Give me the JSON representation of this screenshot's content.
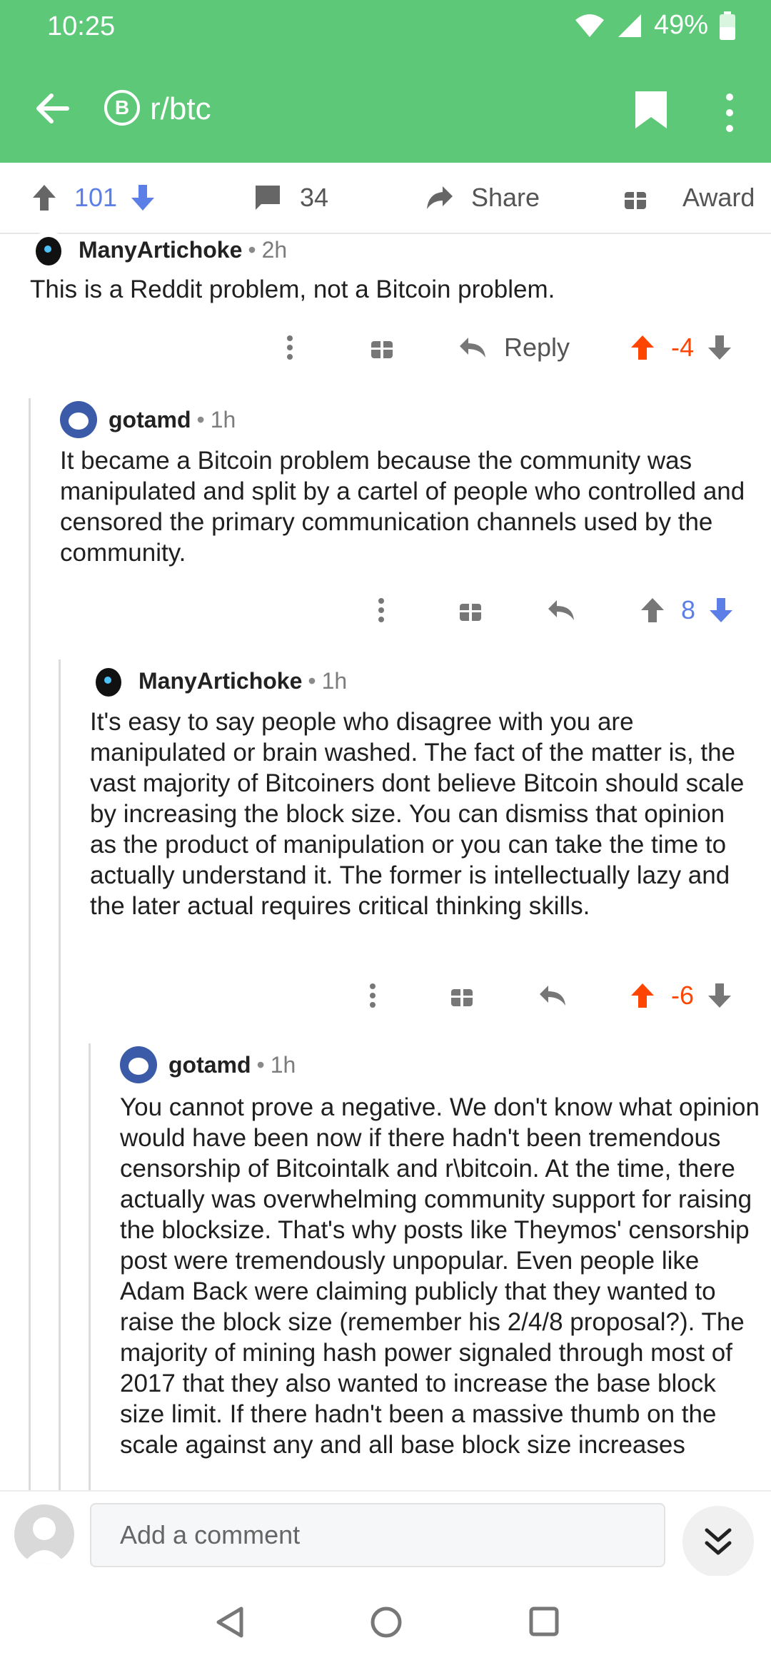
{
  "status": {
    "time": "10:25",
    "battery": "49%"
  },
  "appbar": {
    "subreddit": "r/btc",
    "sub_icon_letter": "B"
  },
  "postbar": {
    "upvotes": "101",
    "comments": "34",
    "share_label": "Share",
    "award_label": "Award"
  },
  "comments": [
    {
      "user": "ManyArtichoke",
      "time": "2h",
      "body": "This is a Reddit problem, not a Bitcoin problem.",
      "reply_label": "Reply",
      "score": "-4"
    },
    {
      "user": "gotamd",
      "time": "1h",
      "body": "It became a Bitcoin problem because the community was manipulated and split by a cartel of people who controlled and censored the primary communication channels used by the community.",
      "score": "8"
    },
    {
      "user": "ManyArtichoke",
      "time": "1h",
      "body": "It's easy to say people who disagree with you are manipulated or brain washed. The fact of the matter is, the vast majority of Bitcoiners dont believe Bitcoin should scale by increasing the block size. You can dismiss that opinion as the product of manipulation or you can take the time to actually understand it. The former is intellectually lazy and the later actual requires critical thinking skills.",
      "score": "-6"
    },
    {
      "user": "gotamd",
      "time": "1h",
      "body": "You cannot prove a negative. We don't know what opinion would have been now if there hadn't been tremendous censorship of Bitcointalk and r\\bitcoin. At the time, there actually was overwhelming community support for raising the blocksize. That's why posts like Theymos' censorship post were tremendously unpopular. Even people like Adam Back were claiming publicly that they wanted to raise the block size (remember his 2/4/8 proposal?). The majority of mining hash power signaled through most of 2017 that they also wanted to increase the base block size limit. If there hadn't been a massive thumb on the scale against any and all base block size increases"
    }
  ],
  "bottom": {
    "placeholder": "Add a comment"
  },
  "colors": {
    "header_green": "#5cc878",
    "upvote_orange": "#ff4500",
    "vote_blue": "#5b7fe6"
  }
}
